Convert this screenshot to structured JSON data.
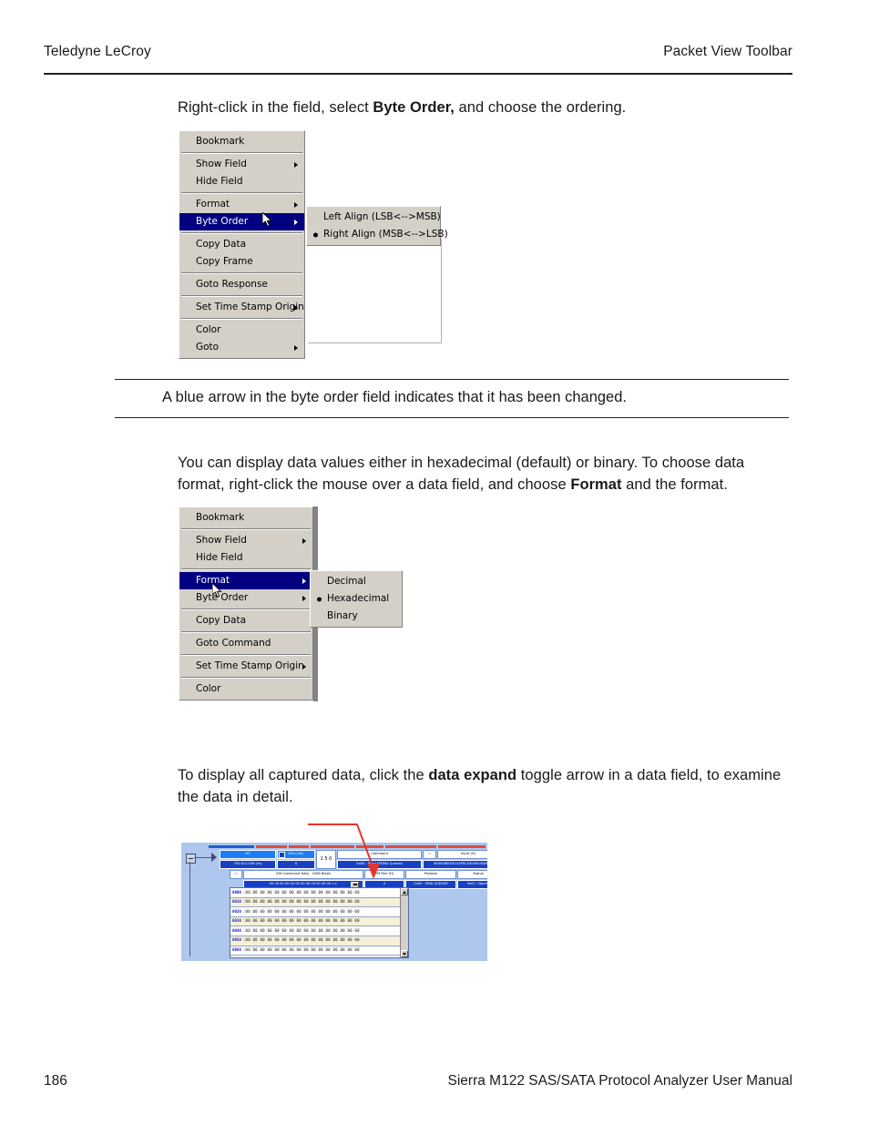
{
  "header": {
    "left": "Teledyne LeCroy",
    "right": "Packet View Toolbar"
  },
  "footer": {
    "page_number": "186",
    "title": "Sierra M122 SAS/SATA Protocol Analyzer User Manual"
  },
  "paragraphs": {
    "p1_a": "Right-click in the field, select ",
    "p1_b": "Byte Order,",
    "p1_c": " and choose the ordering.",
    "p2_a": "You can display data values either in hexadecimal (default) or binary. To choose data format, right-click the mouse over a data field, and choose ",
    "p2_b": "Format",
    "p2_c": " and the format.",
    "p3_a": "To display all captured data, click the ",
    "p3_b": "data expand",
    "p3_c": " toggle arrow in a data field, to examine the data in detail."
  },
  "note": {
    "text": "A blue arrow in the byte order field indicates that it has been changed."
  },
  "context_menu_1": {
    "items": [
      {
        "label": "Bookmark",
        "submenu": false,
        "selected": false,
        "sep_after": true
      },
      {
        "label": "Show Field",
        "submenu": true,
        "selected": false,
        "sep_after": false
      },
      {
        "label": "Hide Field",
        "submenu": false,
        "selected": false,
        "sep_after": true
      },
      {
        "label": "Format",
        "submenu": true,
        "selected": false,
        "sep_after": false
      },
      {
        "label": "Byte Order",
        "submenu": true,
        "selected": true,
        "sep_after": true
      },
      {
        "label": "Copy Data",
        "submenu": false,
        "selected": false,
        "sep_after": false
      },
      {
        "label": "Copy Frame",
        "submenu": false,
        "selected": false,
        "sep_after": true
      },
      {
        "label": "Goto Response",
        "submenu": false,
        "selected": false,
        "sep_after": true
      },
      {
        "label": "Set Time Stamp Origin",
        "submenu": true,
        "selected": false,
        "sep_after": true
      },
      {
        "label": "Color",
        "submenu": false,
        "selected": false,
        "sep_after": false
      },
      {
        "label": "Goto",
        "submenu": true,
        "selected": false,
        "sep_after": false
      }
    ]
  },
  "context_submenu_1": {
    "items": [
      {
        "label": "Left Align (LSB<-->MSB)",
        "checked": false
      },
      {
        "label": "Right Align (MSB<-->LSB)",
        "checked": true
      }
    ]
  },
  "context_menu_2": {
    "items": [
      {
        "label": "Bookmark",
        "submenu": false,
        "selected": false,
        "sep_after": true
      },
      {
        "label": "Show Field",
        "submenu": true,
        "selected": false,
        "sep_after": false
      },
      {
        "label": "Hide Field",
        "submenu": false,
        "selected": false,
        "sep_after": true
      },
      {
        "label": "Format",
        "submenu": true,
        "selected": true,
        "sep_after": false
      },
      {
        "label": "Byte Order",
        "submenu": true,
        "selected": false,
        "sep_after": true
      },
      {
        "label": "Copy Data",
        "submenu": false,
        "selected": false,
        "sep_after": true
      },
      {
        "label": "Goto Command",
        "submenu": false,
        "selected": false,
        "sep_after": true
      },
      {
        "label": "Set Time Stamp Origin",
        "submenu": true,
        "selected": false,
        "sep_after": true
      },
      {
        "label": "Color",
        "submenu": false,
        "selected": false,
        "sep_after": false
      }
    ]
  },
  "context_submenu_2": {
    "items": [
      {
        "label": "Decimal",
        "checked": false
      },
      {
        "label": "Hexadecimal",
        "checked": true
      },
      {
        "label": "Binary",
        "checked": false
      }
    ]
  },
  "packet_view": {
    "row1_headers": [
      "H2",
      "ATA Cmd.",
      "1 5 0",
      "Command",
      "Input (H)"
    ],
    "row1_values": [
      "750.613.528 (ns)",
      "6",
      "0x60 : Read FPDMA Queued",
      "6004080000142F8C0400004008"
    ],
    "row2_headers": [
      "ATA Command Data , 2048 Bytes",
      "PM Port (H)",
      "Protocol",
      "Status"
    ],
    "row2_values": [
      "00 00 00 00 00 00 00 00 00 00 00 00  >>",
      "0",
      "0x00 : DMA QUEUED",
      "0x01 : Norma"
    ],
    "hex_rows": [
      {
        "offset": "0000",
        "bytes": ":00 00 00 00 00 00 00 00 00 00 00 00 00 00 00 00"
      },
      {
        "offset": "0010",
        "bytes": ":00 00 00 00 00 00 00 00 00 00 00 00 00 00 00 00"
      },
      {
        "offset": "0020",
        "bytes": ":00 00 00 00 00 00 00 00 00 00 00 00 00 00 00 00"
      },
      {
        "offset": "0030",
        "bytes": ":00 00 00 00 00 00 00 00 00 00 00 00 00 00 00 00"
      },
      {
        "offset": "0040",
        "bytes": ":00 00 00 00 00 00 00 00 00 00 00 00 00 00 00 00"
      },
      {
        "offset": "0050",
        "bytes": ":00 00 00 00 00 00 00 00 00 00 00 00 00 00 00 00"
      },
      {
        "offset": "0060",
        "bytes": ":00 00 00 00 00 00 00 00 00 00 00 00 00 00 00 00"
      }
    ]
  },
  "colors": {
    "menu_face": "#d4d0c8",
    "menu_highlight": "#000080",
    "packet_header_blue": "#1b7ef5",
    "packet_value_blue": "#1740c4",
    "packet_background": "#aec7ef",
    "callout_red": "#e8342a",
    "rule_black": "#231f20"
  }
}
